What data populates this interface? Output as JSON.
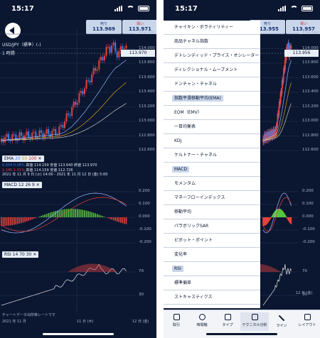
{
  "status": {
    "time": "15:17"
  },
  "quote": {
    "sell_label": "売り",
    "buy_label": "買い"
  },
  "left": {
    "sell_price": "113.969",
    "buy_price": "113.971",
    "pair": "USD/JPY（標準）(-)",
    "timeframe": "1 時間",
    "current_price": "113.970",
    "axis": [
      "114.200",
      "114.000",
      "113.800",
      "113.600",
      "113.400",
      "113.200",
      "113.000",
      "112.800",
      "112.600"
    ],
    "ema": {
      "label": "EMA",
      "p1": "20",
      "p2": "50",
      "p3": "100",
      "close": "✕",
      "row1_a": "0.064",
      "row1_b": "0.06%",
      "row1_c": "高値 114.159",
      "row1_d": "安値 113.640",
      "row1_e": "終値 113.970",
      "row2_a": "1.145",
      "row2_b": "1.01%",
      "row2_c": "高値 114.159",
      "row2_d": "安値 112.726",
      "range": "2021 年 11 月 9 日 (火) 14:00 - 2021 年 11 月 12 日 (金) 5:00"
    },
    "macd": {
      "label": "MACD",
      "p1": "12",
      "p2": "26",
      "p3": "9",
      "close": "✕",
      "axis": [
        "0.200",
        "0.100",
        "0.000",
        "-0.100",
        "-0.200"
      ]
    },
    "rsi": {
      "label": "RSI",
      "p1": "14",
      "p2": "70",
      "p3": "30",
      "close": "✕",
      "axis": [
        "70",
        "30"
      ]
    },
    "chart_note": "チャートデータ出所等レートです",
    "date_axis": [
      "2021 年 11 月",
      "11 日 (木)",
      "12 日 (金)"
    ]
  },
  "right": {
    "sell_price": "113.955",
    "buy_price": "113.957",
    "current_price": "113.956",
    "axis": [
      "114.200",
      "114.000",
      "113.800",
      "113.600",
      "113.400",
      "113.200",
      "113.000",
      "112.800",
      "112.600"
    ],
    "macd_axis": [
      "0.200",
      "0.100",
      "0.000",
      "-0.100",
      "-0.200"
    ],
    "rsi_axis": [
      "70",
      "30"
    ],
    "date_label": "12 日 (金)",
    "menu": [
      "チャイキン・ボラティリティー",
      "商品チャネル指数",
      "デトレンディッド・プライス・オシレーター",
      "ディレクショナル・ムーブメント",
      "ドンチャン・チャネル",
      "指数平滑移動平均(EMA)",
      "EOM（EMV）",
      "一目均衡表",
      "KDJ",
      "ケルトナー・チャネル",
      "MACD",
      "モメンタム",
      "マネーフローインデックス",
      "移動平均",
      "パラボリックSAR",
      "ピボット・ポイント",
      "変化率",
      "RSI",
      "標準偏差",
      "ストキャスティクス"
    ],
    "menu_selected": [
      "指数平滑移動平均(EMA)",
      "MACD",
      "RSI"
    ],
    "tabs": [
      "取引",
      "時間軸",
      "タイプ",
      "テクニカル分析",
      "ライン",
      "レイアウト"
    ],
    "active_tab": "テクニカル分析"
  },
  "colors": {
    "bg": "#0b1630",
    "up": "#e8413c",
    "down": "#3d7de8",
    "macd_pos": "#58c43e",
    "macd_neg": "#e8413c"
  }
}
